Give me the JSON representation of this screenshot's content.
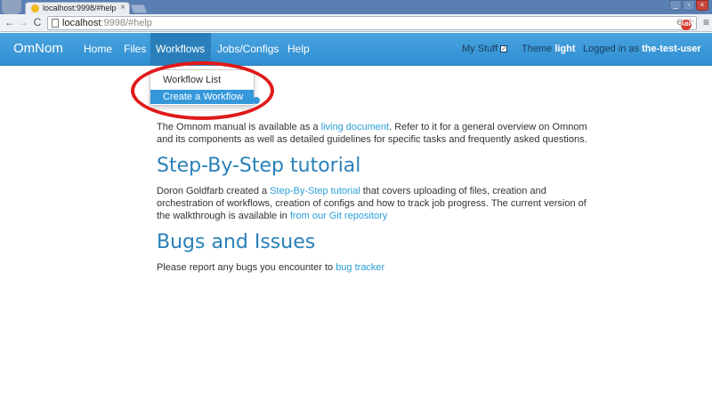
{
  "browser": {
    "tab_title": "localhost:9998/#help",
    "tab_close": "×",
    "url_host": "localhost",
    "url_rest": ":9998/#help",
    "back_glyph": "←",
    "forward_glyph": "→",
    "reload_glyph": "C",
    "zoom_glyph": "⊖",
    "star_glyph": "☆",
    "abp_text": "ABP",
    "wrench_glyph": "≡",
    "win_min": "_",
    "win_max": "▫",
    "win_close": "×"
  },
  "navbar": {
    "brand": "OmNom",
    "items": [
      {
        "label": "Home"
      },
      {
        "label": "Files"
      },
      {
        "label": "Workflows"
      },
      {
        "label": "Jobs/Configs"
      },
      {
        "label": "Help"
      }
    ],
    "my_stuff_label": "My Stuff",
    "my_stuff_check": "✓",
    "theme_label": "Theme",
    "theme_value": "light",
    "logged_in_label": "Logged in as",
    "user": "the-test-user"
  },
  "dropdown": {
    "items": [
      {
        "label": "Workflow List"
      },
      {
        "label": "Create a Workflow"
      }
    ]
  },
  "content": {
    "manual": {
      "pre": "The Omnom manual is available as a ",
      "link": "living document",
      "post": ". Refer to it for a general overview on Omnom and its components as well as detailed guidelines for specific tasks and frequently asked questions."
    },
    "tutorial_heading": "Step-By-Step tutorial",
    "tutorial": {
      "pre": "Doron Goldfarb created a ",
      "link": "Step-By-Step tutorial",
      "mid": " that covers uploading of files, creation and orchestration of workflows, creation of configs and how to track job progress. The current version of the walkthrough is available in ",
      "link2": "from our Git repository"
    },
    "bugs_heading": "Bugs and Issues",
    "bugs": {
      "pre": "Please report any bugs you encounter to ",
      "link": "bug tracker"
    }
  },
  "colors": {
    "navbar": "#3498db",
    "navbar_active": "#2a7fba",
    "heading": "#2980b9",
    "link": "#2a9fd6",
    "annotation": "#e01919"
  }
}
